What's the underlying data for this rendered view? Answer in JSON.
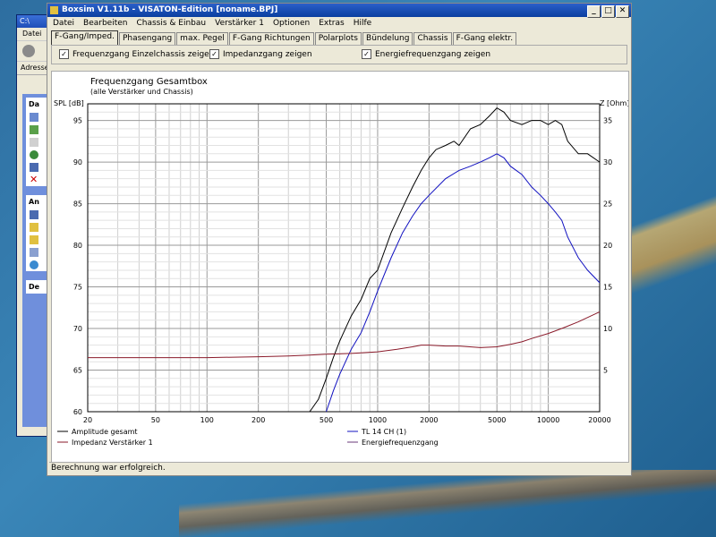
{
  "background_window": {
    "title": "C:\\",
    "menu_label": "Datei",
    "address_label": "Adresse",
    "panels": [
      {
        "header": "Da"
      },
      {
        "header": "An"
      },
      {
        "header": "De"
      }
    ]
  },
  "window": {
    "title": "Boxsim V1.11b - VISATON-Edition [noname.BPJ]",
    "menu": [
      "Datei",
      "Bearbeiten",
      "Chassis & Einbau",
      "Verstärker 1",
      "Optionen",
      "Extras",
      "Hilfe"
    ],
    "tabs": [
      "F-Gang/Imped.",
      "Phasengang",
      "max. Pegel",
      "F-Gang Richtungen",
      "Polarplots",
      "Bündelung",
      "Chassis",
      "F-Gang elektr."
    ],
    "active_tab": "F-Gang/Imped.",
    "checkboxes": [
      {
        "label": "Frequenzgang Einzelchassis zeigen",
        "checked": true
      },
      {
        "label": "Impedanzgang zeigen",
        "checked": true
      },
      {
        "label": "Energiefrequenzgang zeigen",
        "checked": true
      }
    ],
    "status": "Berechnung war erfolgreich."
  },
  "chart_data": {
    "type": "line",
    "title": "Frequenzgang Gesamtbox",
    "subtitle": "(alle Verstärker und Chassis)",
    "ylabel_left": "SPL [dB]",
    "ylabel_right": "Z [Ohm]",
    "x_scale": "log",
    "xlim": [
      20,
      20000
    ],
    "ylim_left": [
      60,
      97
    ],
    "ylim_right": [
      0,
      37
    ],
    "x_ticks": [
      "20",
      "50",
      "100",
      "200",
      "500",
      "1000",
      "2000",
      "5000",
      "10000",
      "20000"
    ],
    "y_ticks_left": [
      "60",
      "65",
      "70",
      "75",
      "80",
      "85",
      "90",
      "95"
    ],
    "y_ticks_right": [
      "5",
      "10",
      "15",
      "20",
      "25",
      "30",
      "35"
    ],
    "grid": true,
    "series": [
      {
        "name": "Amplitude gesamt",
        "color": "#000000",
        "axis": "left",
        "x": [
          400,
          450,
          500,
          550,
          600,
          700,
          800,
          900,
          1000,
          1200,
          1400,
          1600,
          1800,
          2000,
          2200,
          2500,
          2800,
          3000,
          3500,
          4000,
          4500,
          5000,
          5500,
          6000,
          7000,
          8000,
          9000,
          10000,
          11000,
          12000,
          13000,
          15000,
          17000,
          20000
        ],
        "y": [
          60,
          61.5,
          64,
          66.5,
          68.5,
          71.5,
          73.5,
          76,
          77,
          81.5,
          84.5,
          87,
          89,
          90.5,
          91.5,
          92,
          92.5,
          92,
          94,
          94.5,
          95.5,
          96.5,
          96,
          95,
          94.5,
          95,
          95,
          94.5,
          95,
          94.5,
          92.5,
          91,
          91,
          90
        ]
      },
      {
        "name": "TL 14 CH (1)",
        "color": "#1010c0",
        "axis": "left",
        "x": [
          500,
          550,
          600,
          700,
          800,
          900,
          1000,
          1200,
          1400,
          1600,
          1800,
          2000,
          2500,
          3000,
          3500,
          4000,
          4500,
          5000,
          5500,
          6000,
          7000,
          8000,
          9000,
          10000,
          11000,
          12000,
          13000,
          15000,
          17000,
          20000
        ],
        "y": [
          60,
          62.5,
          64.5,
          67.5,
          69.5,
          72,
          74.5,
          78.5,
          81.5,
          83.5,
          85,
          86,
          88,
          89,
          89.5,
          90,
          90.5,
          91,
          90.5,
          89.5,
          88.5,
          87,
          86,
          85,
          84,
          83,
          81,
          78.5,
          77,
          75.5
        ]
      },
      {
        "name": "Impedanz Verstärker 1",
        "color": "#8a1a2a",
        "axis": "right",
        "x": [
          20,
          50,
          100,
          200,
          300,
          400,
          500,
          700,
          1000,
          1300,
          1600,
          1800,
          2000,
          2500,
          3000,
          4000,
          5000,
          6000,
          7000,
          8000,
          10000,
          12000,
          15000,
          20000
        ],
        "y": [
          6.5,
          6.5,
          6.5,
          6.6,
          6.7,
          6.8,
          6.9,
          7.0,
          7.2,
          7.5,
          7.8,
          8.0,
          8.0,
          7.9,
          7.9,
          7.7,
          7.8,
          8.1,
          8.4,
          8.8,
          9.4,
          10.0,
          10.8,
          12.0
        ]
      },
      {
        "name": "Energiefrequenzgang",
        "color": "#6a3a7a",
        "axis": "left"
      }
    ]
  }
}
